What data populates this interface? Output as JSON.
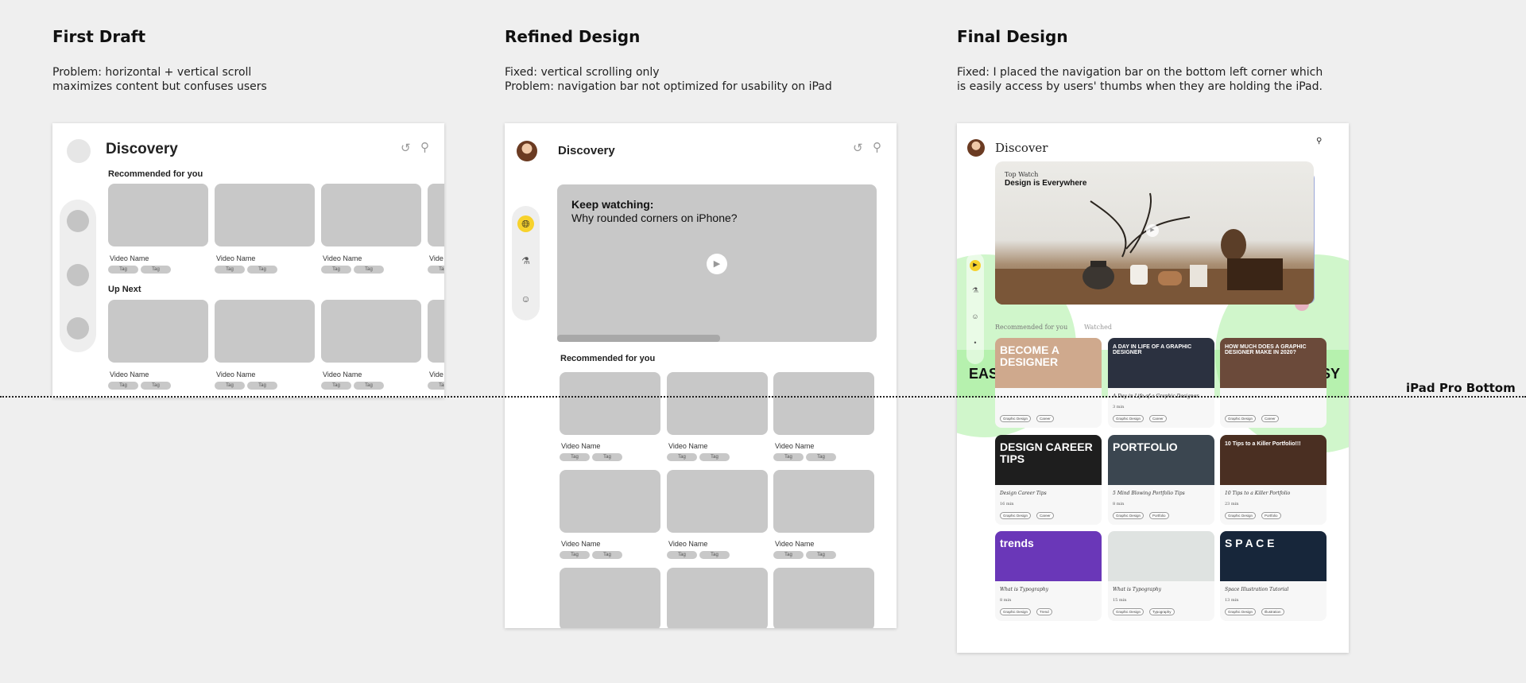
{
  "columns": [
    {
      "title": "First Draft",
      "desc": [
        "Problem: horizontal + vertical scroll",
        "maximizes content but confuses users"
      ]
    },
    {
      "title": "Refined Design",
      "desc": [
        "Fixed: vertical scrolling only",
        "Problem: navigation bar not optimized for usability on iPad"
      ]
    },
    {
      "title": "Final Design",
      "desc": [
        "Fixed: I placed the navigation bar on the bottom left corner which",
        "is easily access by users' thumbs when they are holding the iPad."
      ]
    }
  ],
  "first_draft": {
    "app_title": "Discovery",
    "section_recommended": "Recommended for you",
    "section_up_next": "Up Next",
    "video_name": "Video Name",
    "video_name_cut": "Vide",
    "tag": "Tag",
    "icons": [
      "history-icon",
      "search-icon"
    ]
  },
  "refined": {
    "app_title": "Discovery",
    "keep_watching": "Keep watching:",
    "keep_watching_title": "Why rounded corners on iPhone?",
    "section_recommended": "Recommended for you",
    "video_name": "Video Name",
    "tag": "Tag",
    "nav_icons": [
      "globe-icon",
      "flask-icon",
      "people-icon"
    ]
  },
  "final": {
    "app_title": "Discover",
    "hero_kicker": "Top Watch",
    "hero_title": "Design is Everywhere",
    "tab_recommended": "Recommended for you",
    "tab_watched": "Watched",
    "easy_label": "EASY",
    "videos": [
      {
        "thumb_text": "BECOME A DESIGNER",
        "title": "",
        "meta": "",
        "tags": [
          "Graphic Design",
          "Career"
        ],
        "bg": "#cfa98d"
      },
      {
        "thumb_text": "A DAY IN LIFE OF A GRAPHIC DESIGNER",
        "title": "A Day in Life of a Graphic Designer",
        "meta": "3 min",
        "tags": [
          "Graphic Design",
          "Career"
        ],
        "bg": "#2b3140"
      },
      {
        "thumb_text": "HOW MUCH DOES A GRAPHIC DESIGNER MAKE IN 2020?",
        "title": "",
        "meta": "",
        "tags": [
          "Graphic Design",
          "Career"
        ],
        "bg": "#6b4a3a"
      },
      {
        "thumb_text": "DESIGN CAREER TIPS",
        "title": "Design Career Tips",
        "meta": "16 min",
        "tags": [
          "Graphic Design",
          "Career"
        ],
        "bg": "#1e1e1e"
      },
      {
        "thumb_text": "PORTFOLIO",
        "title": "5 Mind Blowing Portfolio Tips",
        "meta": "8 min",
        "tags": [
          "Graphic Design",
          "Portfolio"
        ],
        "bg": "#3b4650"
      },
      {
        "thumb_text": "10 Tips to a Killer Portfolio!!!",
        "title": "10 Tips to a Killer Portfolio",
        "meta": "23 min",
        "tags": [
          "Graphic Design",
          "Portfolio"
        ],
        "bg": "#4a2f22"
      },
      {
        "thumb_text": "trends",
        "title": "What is Typography",
        "meta": "8 min",
        "tags": [
          "Graphic Design",
          "Trend"
        ],
        "bg": "#6a37b8"
      },
      {
        "thumb_text": "",
        "title": "What is Typography",
        "meta": "15 min",
        "tags": [
          "Graphic Design",
          "Typography"
        ],
        "bg": "#dfe3e1"
      },
      {
        "thumb_text": "S P A C E",
        "title": "Space Illustration Tutorial",
        "meta": "13 min",
        "tags": [
          "Graphic Design",
          "Illustration"
        ],
        "bg": "#17263a"
      }
    ]
  },
  "ipad_line_label": "iPad Pro Bottom"
}
